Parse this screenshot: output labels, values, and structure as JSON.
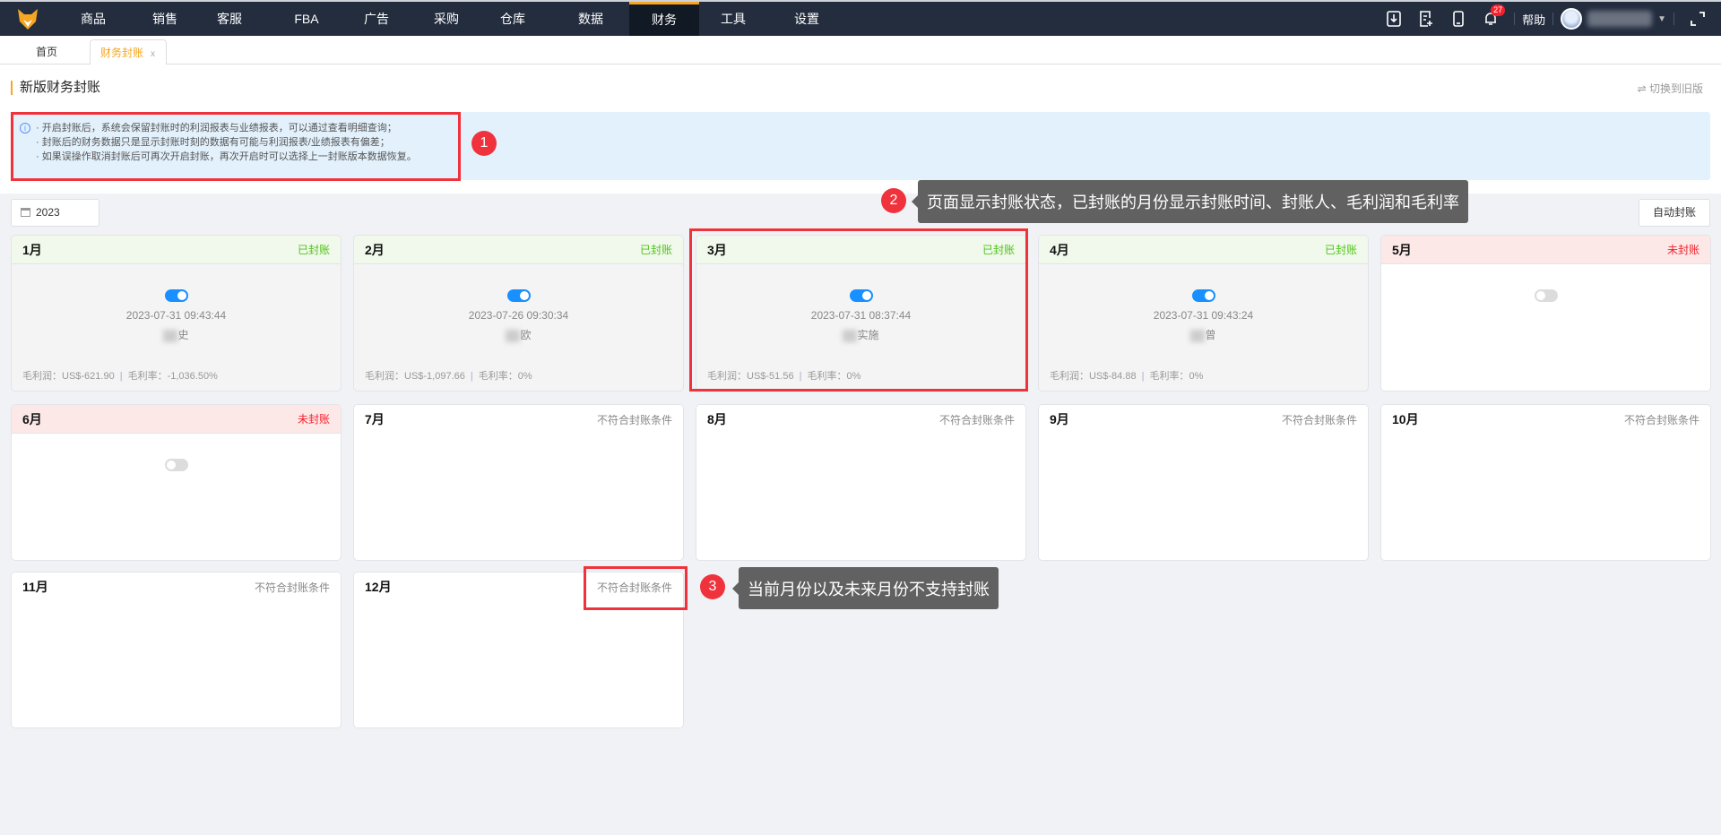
{
  "nav": {
    "items": [
      "商品",
      "销售",
      "客服",
      "FBA",
      "广告",
      "采购",
      "仓库",
      "数据",
      "财务",
      "工具",
      "设置"
    ],
    "active": "财务",
    "notifications": "27",
    "help": "帮助"
  },
  "tabs": {
    "home": "首页",
    "active": "财务封账",
    "close": "x"
  },
  "page": {
    "title": "新版财务封账",
    "switch": "⇌ 切换到旧版",
    "info": [
      "· 开启封账后，系统会保留封账时的利润报表与业绩报表，可以通过查看明细查询；",
      "· 封账后的财务数据只是显示封账时刻的数据有可能与利润报表/业绩报表有偏差；",
      "· 如果误操作取消封账后可再次开启封账，再次开启时可以选择上一封账版本数据恢复。"
    ],
    "year": "2023",
    "auto_button": "自动封账"
  },
  "annotations": {
    "n1": "1",
    "n2": "2",
    "n3": "3",
    "tip2": "页面显示封账状态，已封账的月份显示封账时间、封账人、毛利润和毛利率",
    "tip3": "当前月份以及未来月份不支持封账"
  },
  "labels": {
    "profit": "毛利润：",
    "rate": "毛利率："
  },
  "cards": [
    {
      "month": "1月",
      "status": "已封账",
      "date": "2023-07-31 09:43:44",
      "who": "史",
      "profit": "US$-621.90",
      "rate": "-1,036.50%"
    },
    {
      "month": "2月",
      "status": "已封账",
      "date": "2023-07-26 09:30:34",
      "who": "欧",
      "profit": "US$-1,097.66",
      "rate": "0%"
    },
    {
      "month": "3月",
      "status": "已封账",
      "date": "2023-07-31 08:37:44",
      "who": "实施",
      "profit": "US$-51.56",
      "rate": "0%"
    },
    {
      "month": "4月",
      "status": "已封账",
      "date": "2023-07-31 09:43:24",
      "who": "曾",
      "profit": "US$-84.88",
      "rate": "0%"
    },
    {
      "month": "5月",
      "status": "未封账"
    },
    {
      "month": "6月",
      "status": "未封账"
    },
    {
      "month": "7月",
      "status": "不符合封账条件"
    },
    {
      "month": "8月",
      "status": "不符合封账条件"
    },
    {
      "month": "9月",
      "status": "不符合封账条件"
    },
    {
      "month": "10月",
      "status": "不符合封账条件"
    },
    {
      "month": "11月",
      "status": "不符合封账条件"
    },
    {
      "month": "12月",
      "status": "不符合封账条件"
    }
  ]
}
